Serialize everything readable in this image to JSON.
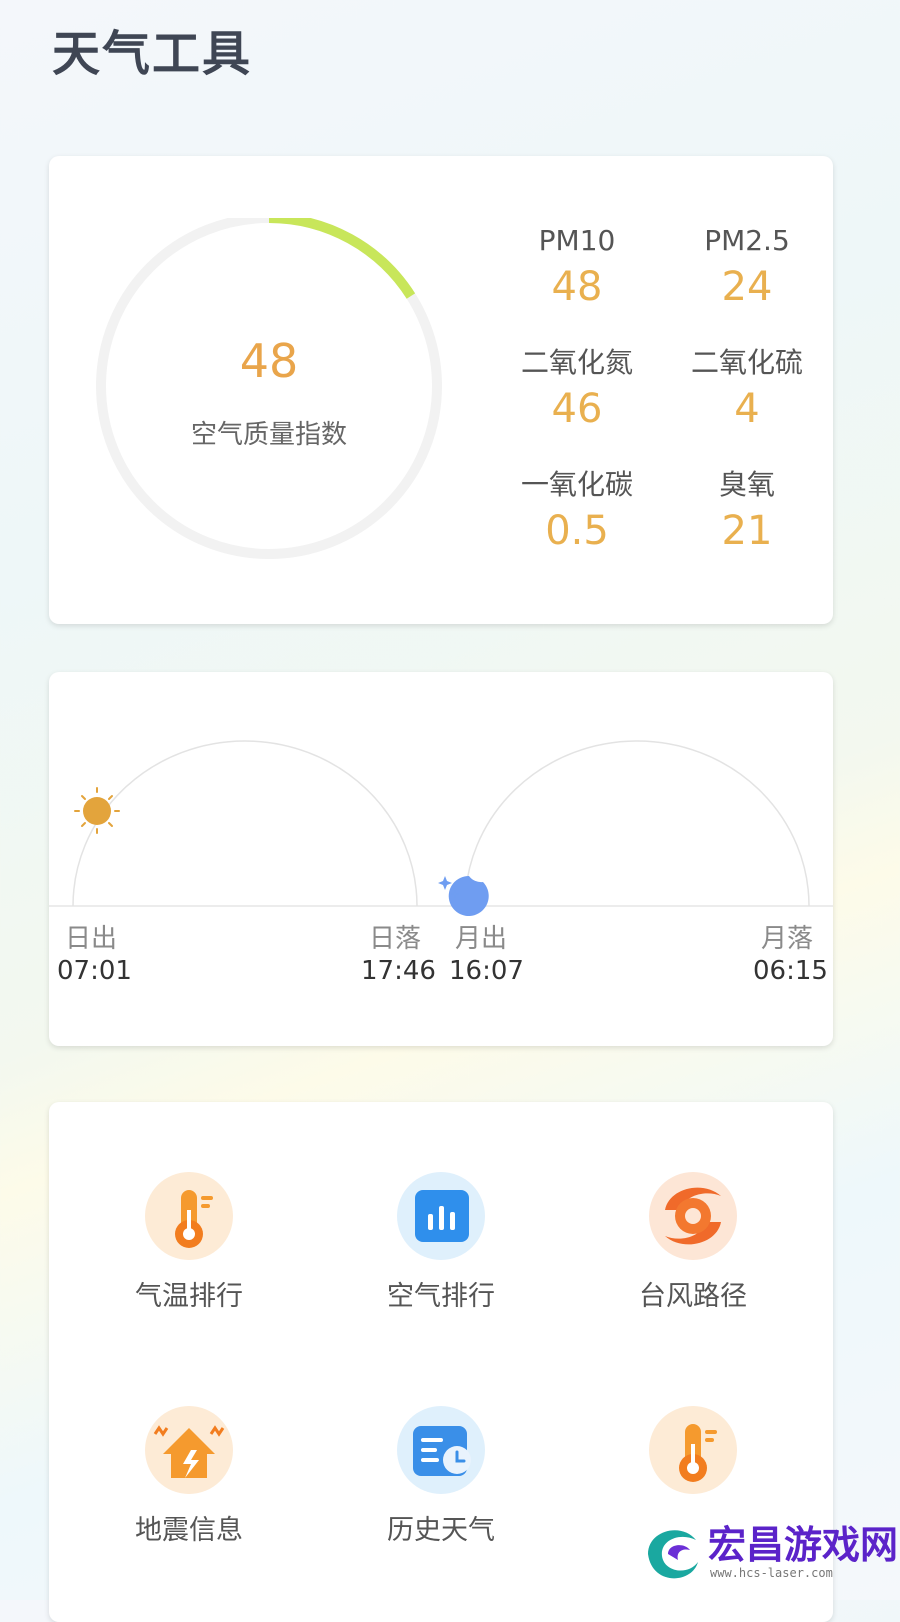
{
  "page": {
    "title": "天气工具"
  },
  "air_quality": {
    "aqi_value": "48",
    "aqi_label": "空气质量指数",
    "aqi_progress": 0.16,
    "ring_colors": {
      "track": "#f2f2f2",
      "progress": "#c8e65a"
    },
    "pollutants": [
      {
        "name": "PM10",
        "value": "48"
      },
      {
        "name": "PM2.5",
        "value": "24"
      },
      {
        "name": "二氧化氮",
        "value": "46"
      },
      {
        "name": "二氧化硫",
        "value": "4"
      },
      {
        "name": "一氧化碳",
        "value": "0.5"
      },
      {
        "name": "臭氧",
        "value": "21"
      }
    ]
  },
  "sun_moon": {
    "sunrise": {
      "label": "日出",
      "time": "07:01"
    },
    "sunset": {
      "label": "日落",
      "time": "17:46"
    },
    "moonrise": {
      "label": "月出",
      "time": "16:07"
    },
    "moonset": {
      "label": "月落",
      "time": "06:15"
    },
    "sun_color": "#e3a43c",
    "moon_color": "#6f9df1"
  },
  "tools": [
    {
      "label": "气温排行",
      "icon": "thermometer-icon"
    },
    {
      "label": "空气排行",
      "icon": "bar-chart-icon"
    },
    {
      "label": "台风路径",
      "icon": "typhoon-icon"
    },
    {
      "label": "地震信息",
      "icon": "earthquake-icon"
    },
    {
      "label": "历史天气",
      "icon": "history-calendar-icon"
    },
    {
      "label": "",
      "icon": "thermometer-icon"
    }
  ],
  "watermark": {
    "text": "宏昌游戏网",
    "sub": "www.hcs-laser.com"
  }
}
